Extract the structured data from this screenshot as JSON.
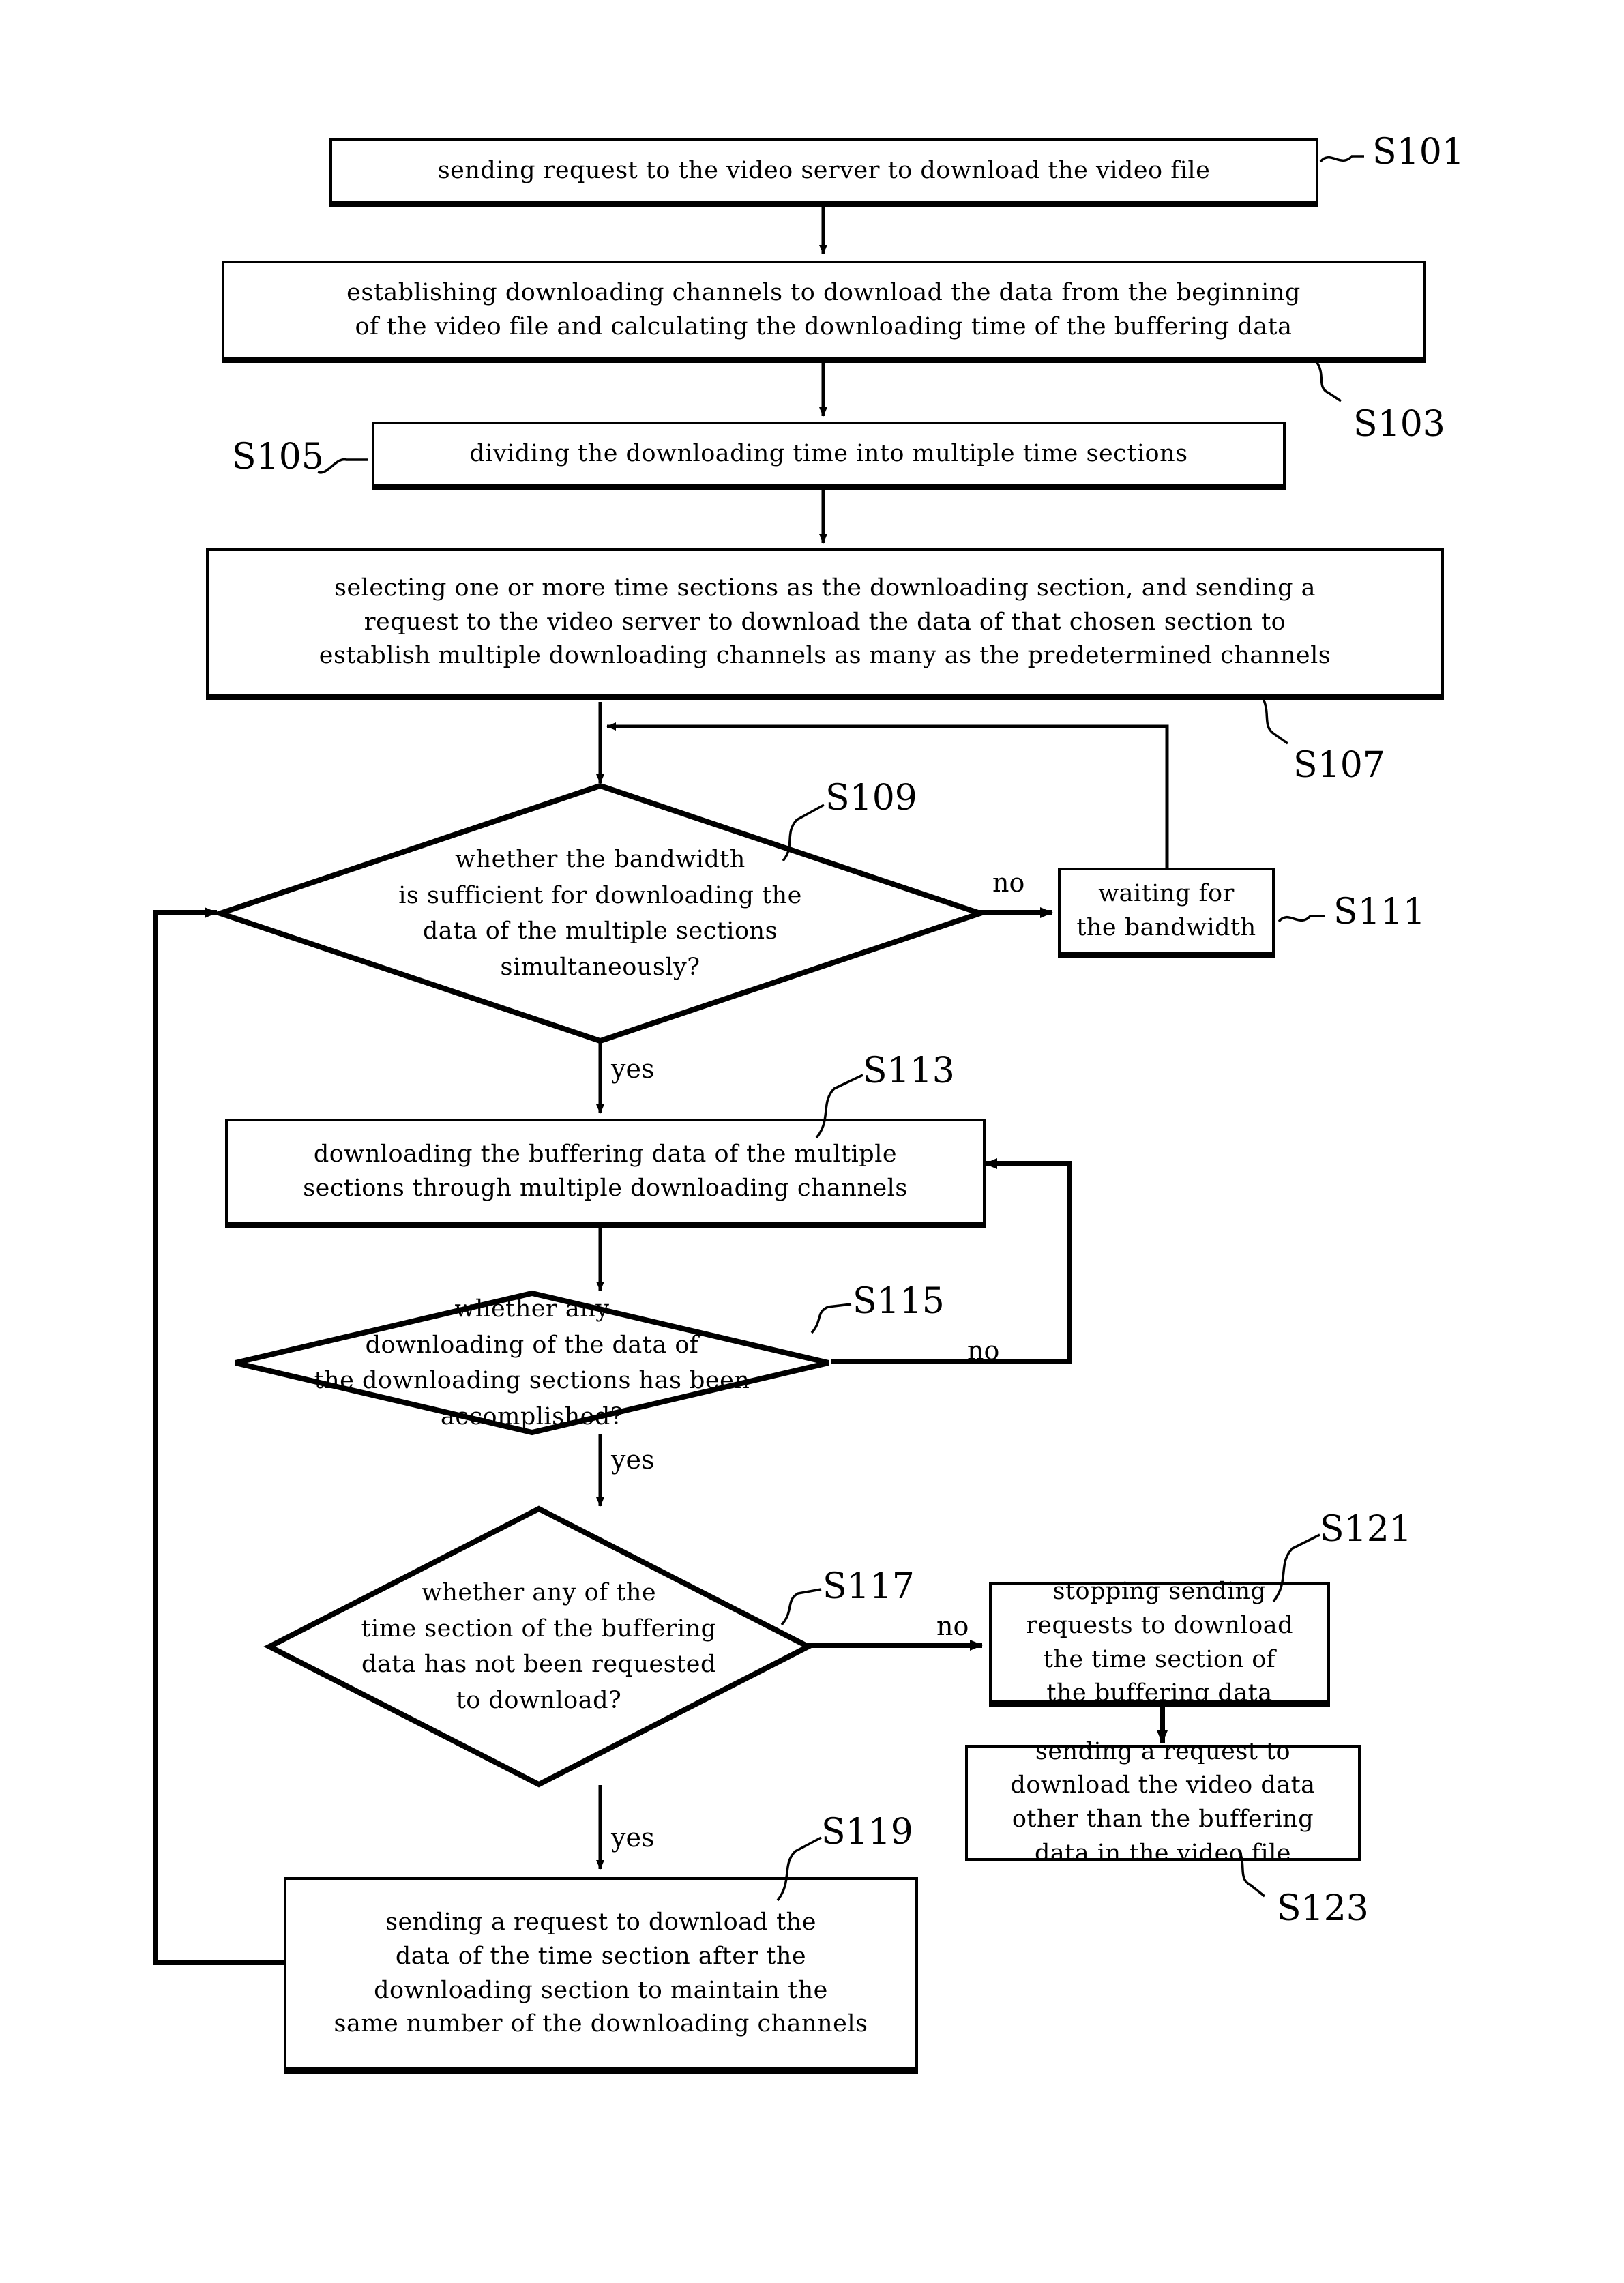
{
  "figure": {
    "type": "flowchart",
    "title": "",
    "orientation": "top-to-bottom"
  },
  "nodes": {
    "s101": {
      "ref": "S101",
      "shape": "process",
      "text": "sending request to the video server to download the video file"
    },
    "s103": {
      "ref": "S103",
      "shape": "process",
      "line1": "establishing downloading channels to download the data from the beginning",
      "line2": "of the video file and calculating the downloading time of the buffering data"
    },
    "s105": {
      "ref": "S105",
      "shape": "process",
      "text": "dividing the downloading time into multiple time sections"
    },
    "s107": {
      "ref": "S107",
      "shape": "process",
      "line1": "selecting one or more time sections as the downloading section, and sending a",
      "line2": "request to the video server to download the data of that chosen section to",
      "line3": "establish multiple downloading channels as many as the predetermined channels"
    },
    "s109": {
      "ref": "S109",
      "shape": "decision",
      "line1": "whether the bandwidth",
      "line2": "is sufficient for downloading the",
      "line3": "data of the multiple sections",
      "line4": "simultaneously?"
    },
    "s111": {
      "ref": "S111",
      "shape": "process",
      "line1": "waiting for",
      "line2": "the bandwidth"
    },
    "s113": {
      "ref": "S113",
      "shape": "process",
      "line1": "downloading the buffering data of the multiple",
      "line2": "sections through multiple downloading channels"
    },
    "s115": {
      "ref": "S115",
      "shape": "decision",
      "line1": "whether any",
      "line2": "downloading of the data of",
      "line3": "the downloading sections has been",
      "line4": "accomplished?"
    },
    "s117": {
      "ref": "S117",
      "shape": "decision",
      "line1": "whether any of the",
      "line2": "time section of the buffering",
      "line3": "data has not been requested",
      "line4": "to download?"
    },
    "s119": {
      "ref": "S119",
      "shape": "process",
      "line1": "sending a request to download the",
      "line2": "data of the time section after the",
      "line3": "downloading section to maintain the",
      "line4": "same number of the downloading channels"
    },
    "s121": {
      "ref": "S121",
      "shape": "process",
      "line1": "stopping sending",
      "line2": "requests to download",
      "line3": "the time section of",
      "line4": "the buffering data"
    },
    "s123": {
      "ref": "S123",
      "shape": "process",
      "line1": "sending a request to",
      "line2": "download the video data",
      "line3": "other than the buffering",
      "line4": "data in the video file"
    }
  },
  "edge_labels": {
    "s109_no": "no",
    "s109_yes": "yes",
    "s115_no": "no",
    "s115_yes": "yes",
    "s117_no": "no",
    "s117_yes": "yes"
  },
  "colors": {
    "stroke": "#000000",
    "fill": "#ffffff",
    "text": "#000000"
  }
}
